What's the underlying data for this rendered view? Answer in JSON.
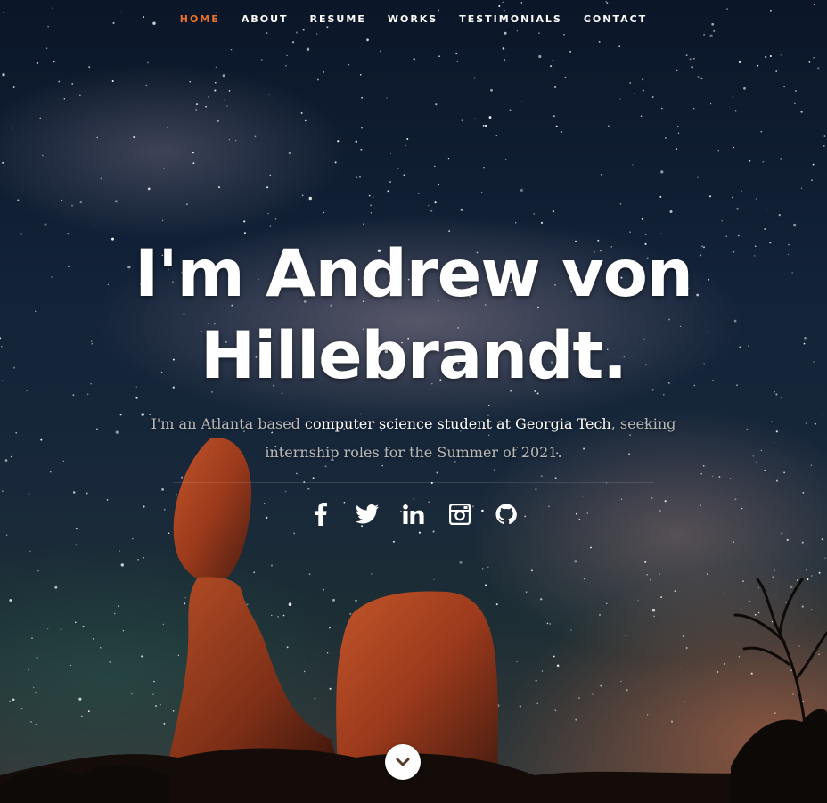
{
  "nav": {
    "items": [
      {
        "label": "Home",
        "active": true
      },
      {
        "label": "About",
        "active": false
      },
      {
        "label": "Resume",
        "active": false
      },
      {
        "label": "Works",
        "active": false
      },
      {
        "label": "Testimonials",
        "active": false
      },
      {
        "label": "Contact",
        "active": false
      }
    ],
    "active_color": "#e8702a"
  },
  "hero": {
    "headline_line1": "I'm Andrew von",
    "headline_line2": "Hillebrandt.",
    "subtitle_pre": "I'm an Atlanta based ",
    "subtitle_highlight": "computer science student at Georgia Tech",
    "subtitle_post": ", seeking internship roles for the Summer of 2021."
  },
  "social": [
    {
      "icon": "facebook-icon"
    },
    {
      "icon": "twitter-icon"
    },
    {
      "icon": "linkedin-icon"
    },
    {
      "icon": "instagram-icon"
    },
    {
      "icon": "github-icon"
    }
  ],
  "scroll": {
    "icon": "chevron-down-icon"
  },
  "colors": {
    "accent": "#e8702a",
    "text": "#ffffff",
    "subtitle_text": "#b9b9b9"
  }
}
